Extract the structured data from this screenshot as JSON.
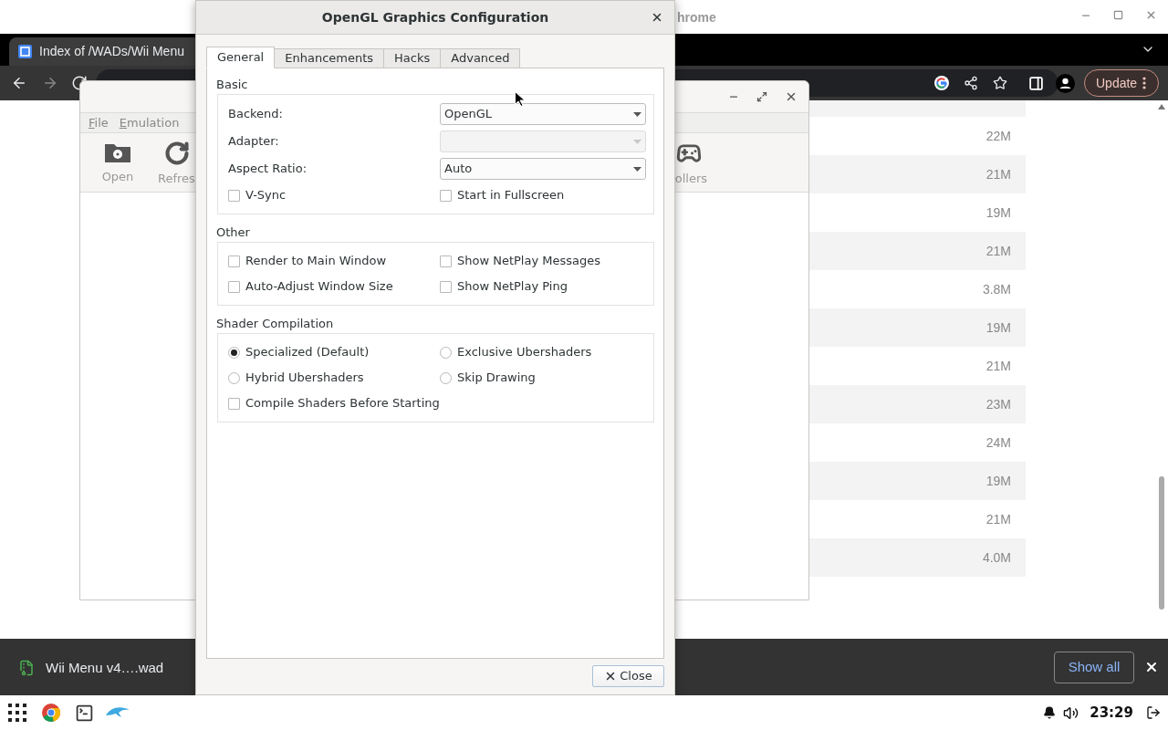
{
  "browser": {
    "title_fragment": "hrome",
    "tab_title": "Index of /WADs/Wii Menu",
    "update_button": "Update",
    "file_sizes": [
      "22M",
      "21M",
      "19M",
      "21M",
      "3.8M",
      "19M",
      "21M",
      "23M",
      "24M",
      "19M",
      "21M",
      "4.0M"
    ]
  },
  "dolphin": {
    "menu": [
      "File",
      "Emulation"
    ],
    "toolbar": [
      {
        "kind": "open",
        "label": "Open"
      },
      {
        "kind": "refresh",
        "label": "Refres"
      },
      {
        "kind": "controllers",
        "label": "ollers"
      }
    ]
  },
  "dialog": {
    "title": "OpenGL Graphics Configuration",
    "tabs": [
      {
        "label": "General",
        "selected": true
      },
      {
        "label": "Enhancements",
        "selected": false
      },
      {
        "label": "Hacks",
        "selected": false
      },
      {
        "label": "Advanced",
        "selected": false
      }
    ],
    "groups": [
      {
        "title": "Basic",
        "items": [
          {
            "kind": "dropdown",
            "label": "Backend:",
            "value": "OpenGL",
            "disabled": false
          },
          {
            "kind": "dropdown",
            "label": "Adapter:",
            "disabled": true
          },
          {
            "kind": "dropdown",
            "label": "Aspect Ratio:",
            "value": "Auto",
            "disabled": false
          },
          {
            "kind": "checkbox",
            "label": "V-Sync",
            "checked": false
          },
          {
            "kind": "checkbox",
            "label": "Start in Fullscreen",
            "checked": false
          }
        ]
      },
      {
        "title": "Other",
        "items": [
          {
            "kind": "checkbox",
            "label": "Render to Main Window",
            "checked": false
          },
          {
            "kind": "checkbox",
            "label": "Show NetPlay Messages",
            "checked": false
          },
          {
            "kind": "checkbox",
            "label": "Auto-Adjust Window Size",
            "checked": false
          },
          {
            "kind": "checkbox",
            "label": "Show NetPlay Ping",
            "checked": false
          }
        ]
      },
      {
        "title": "Shader Compilation",
        "items": [
          {
            "kind": "radio",
            "label": "Specialized (Default)",
            "selected": true
          },
          {
            "kind": "radio",
            "label": "Exclusive Ubershaders",
            "selected": false
          },
          {
            "kind": "radio",
            "label": "Hybrid Ubershaders",
            "selected": false
          },
          {
            "kind": "radio",
            "label": "Skip Drawing",
            "selected": false
          },
          {
            "kind": "checkbox",
            "label": "Compile Shaders Before Starting",
            "checked": false
          }
        ]
      }
    ],
    "close_button": "Close"
  },
  "download_bar": {
    "file": "Wii Menu v4….wad",
    "show_all": "Show all"
  },
  "taskbar": {
    "clock": "23:29"
  }
}
